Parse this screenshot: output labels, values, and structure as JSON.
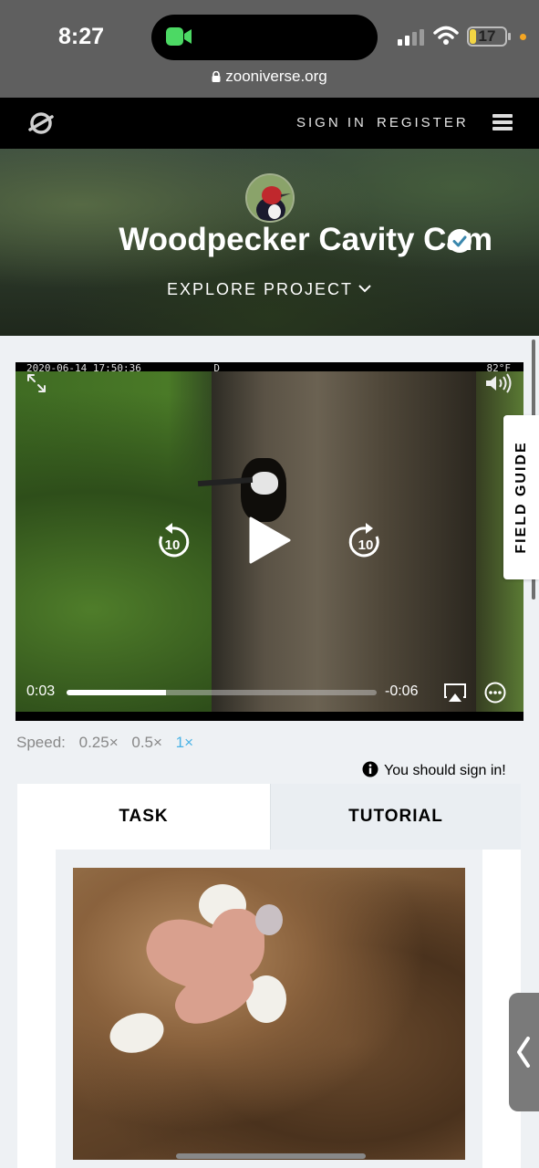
{
  "status_bar": {
    "time": "8:27",
    "battery": "17",
    "battery_level": 0.17,
    "url": "zooniverse.org"
  },
  "header": {
    "sign_in": "SIGN IN",
    "register": "REGISTER",
    "logo_icon": "zooniverse-logo-icon",
    "menu_icon": "hamburger-menu-icon"
  },
  "hero": {
    "title": "Woodpecker Cavity Cam",
    "explore": "EXPLORE PROJECT",
    "verified_color": "#3a87ad"
  },
  "video": {
    "timestamp": "2020-06-14 17:50:36",
    "channel": "D",
    "temperature": "82°F",
    "current": "0:03",
    "remaining": "-0:06",
    "progress": 0.32,
    "skip_back": "10",
    "skip_forward": "10"
  },
  "field_guide": "FIELD GUIDE",
  "speed": {
    "label": "Speed:",
    "options": [
      "0.25×",
      "0.5×",
      "1×"
    ],
    "active": "1×",
    "active_color": "#4ab3e6"
  },
  "notice": "You should sign in!",
  "tabs": {
    "task": "TASK",
    "tutorial": "TUTORIAL"
  }
}
